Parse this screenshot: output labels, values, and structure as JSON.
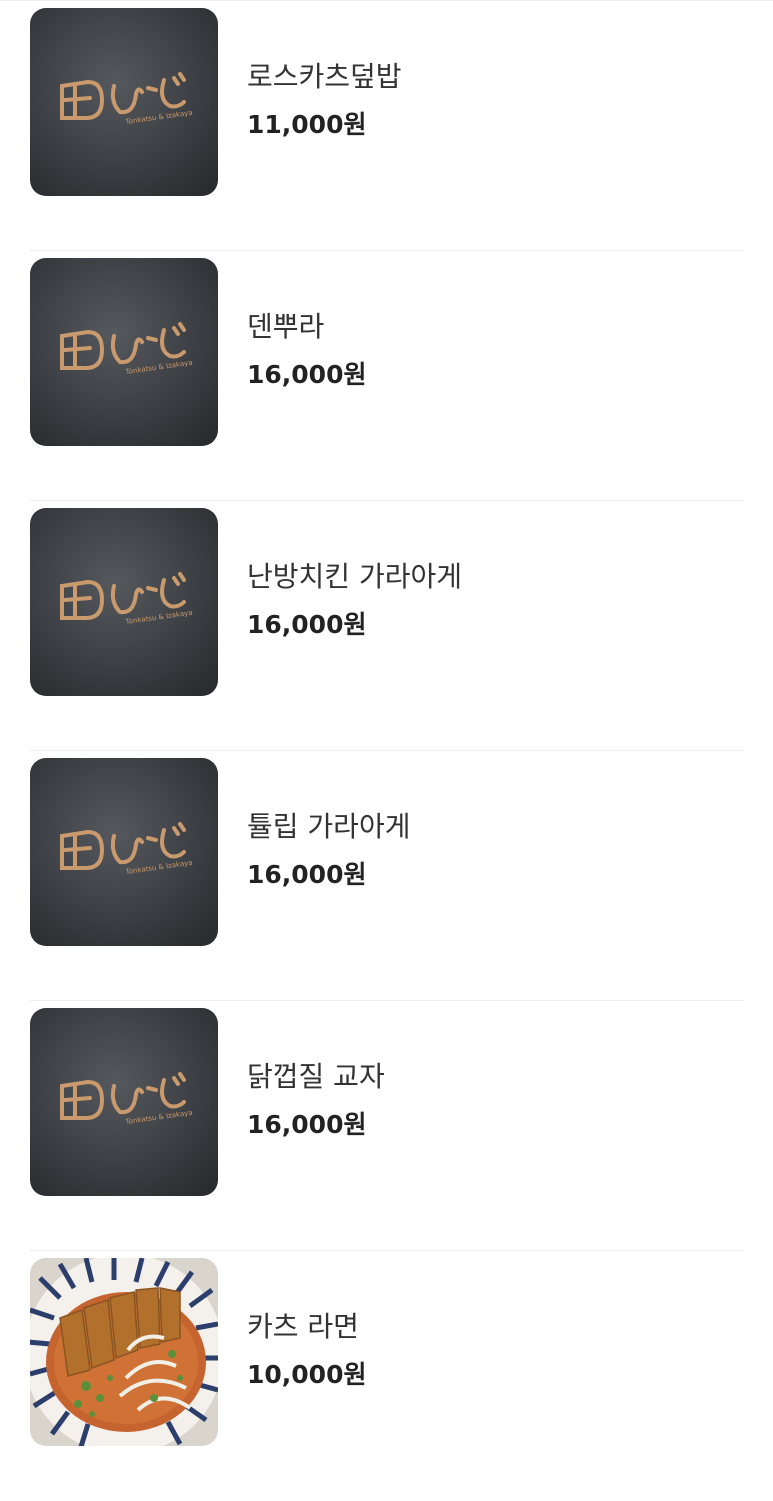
{
  "menu": {
    "items": [
      {
        "name": "로스카츠덮밥",
        "price": "11,000원",
        "image": "restaurant-logo-placeholder"
      },
      {
        "name": "덴뿌라",
        "price": "16,000원",
        "image": "restaurant-logo-placeholder"
      },
      {
        "name": "난방치킨 가라아게",
        "price": "16,000원",
        "image": "restaurant-logo-placeholder"
      },
      {
        "name": "튤립 가라아게",
        "price": "16,000원",
        "image": "restaurant-logo-placeholder"
      },
      {
        "name": "닭껍질 교자",
        "price": "16,000원",
        "image": "restaurant-logo-placeholder"
      },
      {
        "name": "카츠 라면",
        "price": "10,000원",
        "image": "katsu-ramen-photo"
      }
    ]
  },
  "brand": {
    "logo_text": "ひど",
    "logo_subtext": "Tonkatsu & Izakaya"
  },
  "colors": {
    "background": "#ffffff",
    "divider": "#eeeeee",
    "text": "#333333",
    "price": "#222222",
    "logo_card": "#3a3d41",
    "logo_copper": "#c99a6e"
  }
}
